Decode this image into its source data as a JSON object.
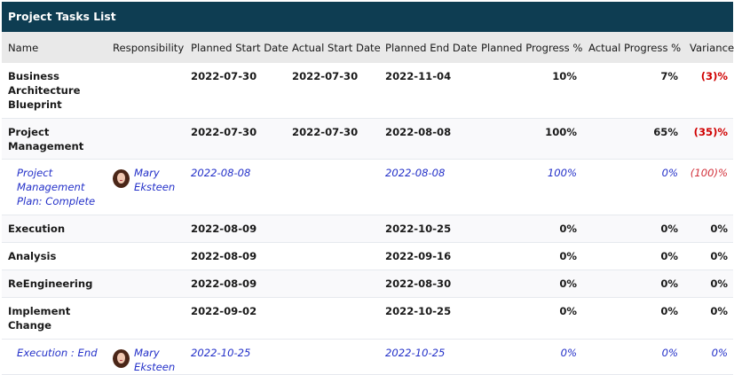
{
  "panel": {
    "title": "Project Tasks List"
  },
  "columns": [
    "Name",
    "Responsibility",
    "Planned Start Date",
    "Actual Start Date",
    "Planned End Date",
    "Planned Progress %",
    "Actual Progress %",
    "Variance"
  ],
  "rows": [
    {
      "name": "Business Architecture Blueprint",
      "responsibility": "",
      "planned_start": "2022-07-30",
      "actual_start": "2022-07-30",
      "planned_end": "2022-11-04",
      "planned_progress": "10%",
      "actual_progress": "7%",
      "variance": "(3)%"
    },
    {
      "name": "Project Management",
      "responsibility": "",
      "planned_start": "2022-07-30",
      "actual_start": "2022-07-30",
      "planned_end": "2022-08-08",
      "planned_progress": "100%",
      "actual_progress": "65%",
      "variance": "(35)%"
    },
    {
      "name": "Project Management Plan: Complete",
      "responsibility": "Mary Eksteen",
      "planned_start": "2022-08-08",
      "actual_start": "",
      "planned_end": "2022-08-08",
      "planned_progress": "100%",
      "actual_progress": "0%",
      "variance": "(100)%"
    },
    {
      "name": "Execution",
      "responsibility": "",
      "planned_start": "2022-08-09",
      "actual_start": "",
      "planned_end": "2022-10-25",
      "planned_progress": "0%",
      "actual_progress": "0%",
      "variance": "0%"
    },
    {
      "name": "Analysis",
      "responsibility": "",
      "planned_start": "2022-08-09",
      "actual_start": "",
      "planned_end": "2022-09-16",
      "planned_progress": "0%",
      "actual_progress": "0%",
      "variance": "0%"
    },
    {
      "name": "ReEngineering",
      "responsibility": "",
      "planned_start": "2022-08-09",
      "actual_start": "",
      "planned_end": "2022-08-30",
      "planned_progress": "0%",
      "actual_progress": "0%",
      "variance": "0%"
    },
    {
      "name": "Implement Change",
      "responsibility": "",
      "planned_start": "2022-09-02",
      "actual_start": "",
      "planned_end": "2022-10-25",
      "planned_progress": "0%",
      "actual_progress": "0%",
      "variance": "0%"
    },
    {
      "name": "Execution : End",
      "responsibility": "Mary Eksteen",
      "planned_start": "2022-10-25",
      "actual_start": "",
      "planned_end": "2022-10-25",
      "planned_progress": "0%",
      "actual_progress": "0%",
      "variance": "0%"
    }
  ],
  "colors": {
    "header_bg": "#0e3d52",
    "column_header_bg": "#e9e9e9",
    "task_text": "#2431c9",
    "negative_variance": "#d00000"
  },
  "icons": {
    "avatar": "user-avatar-photo"
  }
}
